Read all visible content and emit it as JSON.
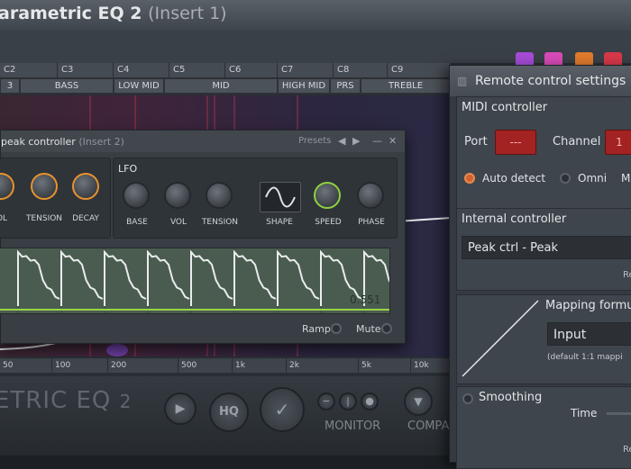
{
  "eq": {
    "title": "arametric EQ 2",
    "title_suffix": "(Insert 1)",
    "notes": [
      "C2",
      "C3",
      "C4",
      "C5",
      "C6",
      "C7",
      "C8",
      "C9"
    ],
    "bands": [
      "BASS",
      "LOW MID",
      "MID",
      "HIGH MID",
      "PRS",
      "TREBLE"
    ],
    "band_left_label": "3",
    "freq_scale": [
      "50",
      "100",
      "200",
      "500",
      "1k",
      "2k",
      "5k",
      "10k"
    ],
    "logo": "ETRIC EQ",
    "logo_sub": "2",
    "hq_label": "HQ",
    "monitor_label": "MONITOR",
    "compare_label": "COMPA"
  },
  "peak_controller": {
    "title": "peak controller",
    "title_suffix": "(Insert 2)",
    "presets_label": "Presets",
    "left_knobs": [
      "OL",
      "TENSION",
      "DECAY"
    ],
    "lfo_label": "LFO",
    "lfo_knobs": [
      "BASE",
      "VOL",
      "TENSION",
      "SHAPE",
      "SPEED",
      "PHASE"
    ],
    "readout": "0.551",
    "ramp_label": "Ramp",
    "mute_label": "Mute"
  },
  "remote_control": {
    "title": "Remote control settings",
    "midi_section": "MIDI controller",
    "port_label": "Port",
    "port_value": "---",
    "channel_label": "Channel",
    "channel_value": "1",
    "auto_detect_label": "Auto detect",
    "omni_label": "Omni",
    "m_label": "M",
    "internal_section": "Internal controller",
    "internal_value": "Peak ctrl - Peak",
    "re_label": "Re",
    "mapping_label": "Mapping formu",
    "mapping_value": "Input",
    "mapping_default": "(default 1:1 mappi",
    "smoothing_label": "Smoothing",
    "time_label": "Time",
    "re_label_2": "Re"
  },
  "colors": {
    "swatch_purple": "#a64bd8",
    "swatch_pink": "#d84bb8",
    "swatch_orange": "#e07a2c",
    "swatch_red": "#d8384a",
    "accent_orange": "#e8922c",
    "accent_green": "#8fd13e",
    "lcd_red": "#a32222"
  }
}
